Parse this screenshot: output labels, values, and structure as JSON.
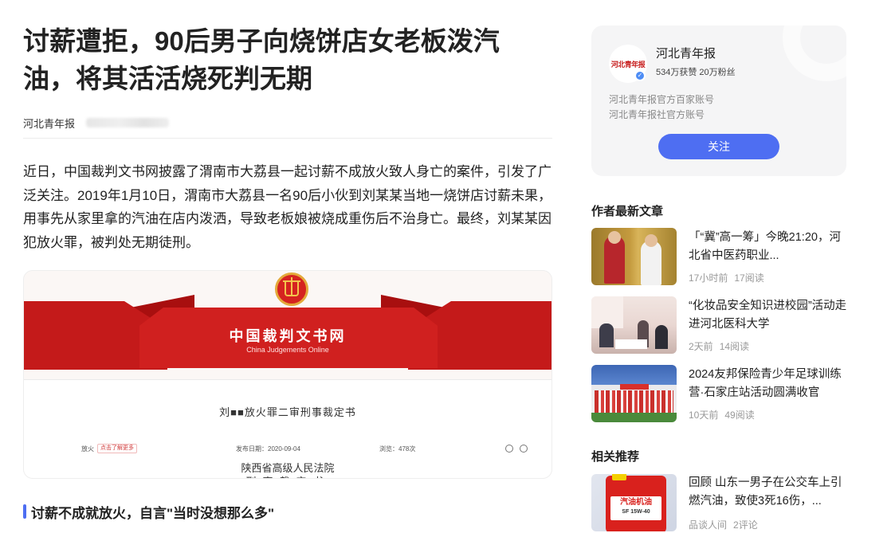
{
  "article": {
    "title": "讨薪遭拒，90后男子向烧饼店女老板泼汽油，将其活活烧死判无期",
    "source": "河北青年报",
    "paragraph": "近日，中国裁判文书网披露了渭南市大荔县一起讨薪不成放火致人身亡的案件，引发了广泛关注。2019年1月10日，渭南市大荔县一名90后小伙到刘某某当地一烧饼店讨薪未果，用事先从家里拿的汽油在店内泼洒，导致老板娘被烧成重伤后不治身亡。最终，刘某某因犯放火罪，被判处无期徒刑。",
    "image": {
      "banner_cn": "中国裁判文书网",
      "banner_en": "China Judgements Online",
      "doc_heading": "刘■■放火罪二审刑事裁定书",
      "meta_label": "放火",
      "meta_tag": "点击了解更多",
      "publish_date": "发布日期：2020-09-04",
      "views": "浏览：478次",
      "court": "陕西省高级人民法院",
      "doc_type": "刑事裁定书"
    },
    "section_heading": "讨薪不成就放火，自言\"当时没想那么多\""
  },
  "author": {
    "logo_text": "河北青年报",
    "name": "河北青年报",
    "stats": "534万获赞 20万粉丝",
    "desc_line1": "河北青年报官方百家账号",
    "desc_line2": "河北青年报社官方账号",
    "follow_label": "关注",
    "verified_mark": "✓"
  },
  "latest": {
    "heading": "作者最新文章",
    "items": [
      {
        "title": "「“冀”高一筹」今晚21:20，河北省中医药职业...",
        "time": "17小时前",
        "reads": "17阅读"
      },
      {
        "title": "“化妆品安全知识进校园”活动走进河北医科大学",
        "time": "2天前",
        "reads": "14阅读"
      },
      {
        "title": "2024友邦保险青少年足球训练营·石家庄站活动圆满收官",
        "time": "10天前",
        "reads": "49阅读"
      }
    ]
  },
  "related": {
    "heading": "相关推荐",
    "items": [
      {
        "title": "回顾 山东一男子在公交车上引燃汽油，致使3死16伤，...",
        "source": "品谈人间",
        "comments": "2评论",
        "thumb_text1": "汽油机油",
        "thumb_text2": "SF 15W-40"
      }
    ]
  },
  "colors": {
    "accent": "#4e6ef2",
    "banner_red": "#c41a1a"
  }
}
